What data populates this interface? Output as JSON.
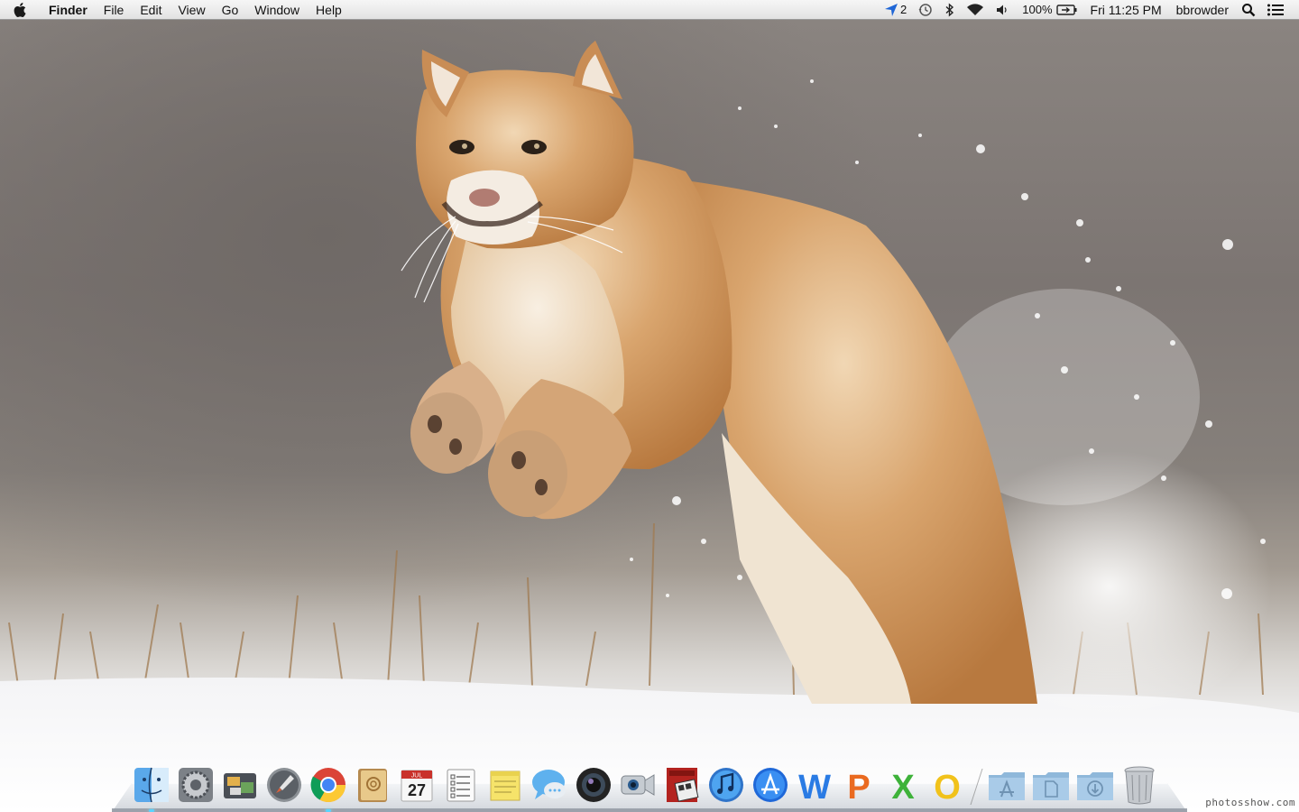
{
  "menubar": {
    "app_name": "Finder",
    "menus": [
      "File",
      "Edit",
      "View",
      "Go",
      "Window",
      "Help"
    ],
    "status": {
      "location_count": "2",
      "battery_percent": "100%",
      "clock": "Fri 11:25 PM",
      "user": "bbrowder"
    }
  },
  "dock": {
    "apps": [
      {
        "name": "Finder",
        "icon": "finder-icon",
        "running": true
      },
      {
        "name": "System Preferences",
        "icon": "system-preferences-icon",
        "running": false
      },
      {
        "name": "Image Capture",
        "icon": "image-capture-icon",
        "running": false
      },
      {
        "name": "Launchpad",
        "icon": "launchpad-icon",
        "running": false
      },
      {
        "name": "Google Chrome",
        "icon": "chrome-icon",
        "running": true
      },
      {
        "name": "Address Book",
        "icon": "address-book-icon",
        "running": false
      },
      {
        "name": "iCal",
        "icon": "calendar-icon",
        "running": false,
        "month": "JUL",
        "day": "27"
      },
      {
        "name": "Reminders",
        "icon": "reminders-icon",
        "running": false
      },
      {
        "name": "Stickies",
        "icon": "stickies-icon",
        "running": false
      },
      {
        "name": "Messages",
        "icon": "messages-icon",
        "running": false
      },
      {
        "name": "Aperture",
        "icon": "aperture-icon",
        "running": false
      },
      {
        "name": "FaceTime",
        "icon": "facetime-icon",
        "running": false
      },
      {
        "name": "Photo Booth",
        "icon": "photo-booth-icon",
        "running": false
      },
      {
        "name": "iTunes",
        "icon": "itunes-icon",
        "running": false
      },
      {
        "name": "App Store",
        "icon": "app-store-icon",
        "running": false
      },
      {
        "name": "Word",
        "icon": "word-icon",
        "running": false,
        "letter": "W"
      },
      {
        "name": "PowerPoint",
        "icon": "powerpoint-icon",
        "running": false,
        "letter": "P"
      },
      {
        "name": "Excel",
        "icon": "excel-icon",
        "running": false,
        "letter": "X"
      },
      {
        "name": "Outlook",
        "icon": "outlook-icon",
        "running": false,
        "letter": "O"
      }
    ],
    "stacks": [
      {
        "name": "Applications",
        "icon": "applications-folder-icon"
      },
      {
        "name": "Documents",
        "icon": "documents-folder-icon"
      },
      {
        "name": "Downloads",
        "icon": "downloads-folder-icon"
      },
      {
        "name": "Trash",
        "icon": "trash-icon"
      }
    ]
  },
  "watermark": "photosshow.com",
  "colors": {
    "menubar_top": "#f6f6f6",
    "menubar_bottom": "#e2e2e2",
    "running_indicator": "#5ad4ff",
    "location_arrow": "#1f66d6"
  }
}
